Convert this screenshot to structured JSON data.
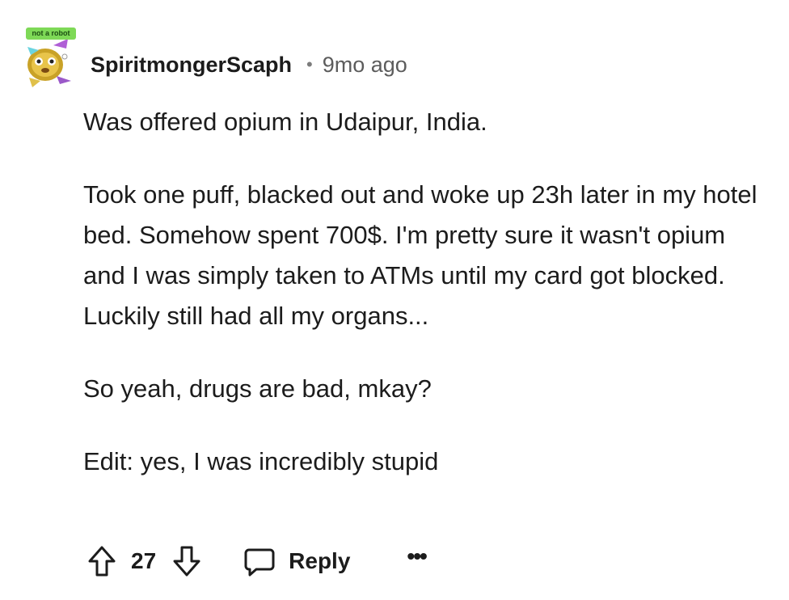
{
  "comment": {
    "avatar": {
      "badge_text": "not a robot",
      "icon": "robot-avatar-icon"
    },
    "username": "SpiritmongerScaph",
    "separator": "•",
    "timestamp": "9mo ago",
    "paragraphs": [
      "Was offered opium in Udaipur, India.",
      "Took one puff, blacked out and woke up 23h later in my hotel bed. Somehow spent 700$. I'm pretty sure it wasn't opium and I was simply taken to ATMs until my card got blocked. Luckily still had all my organs...",
      "So yeah, drugs are bad, mkay?",
      "Edit: yes, I was incredibly stupid"
    ],
    "actions": {
      "upvote_icon": "upvote-arrow-icon",
      "vote_count": "27",
      "downvote_icon": "downvote-arrow-icon",
      "reply_icon": "speech-bubble-icon",
      "reply_label": "Reply",
      "more_label": "•••"
    }
  },
  "colors": {
    "text": "#1c1c1c",
    "meta": "#5c5c5c",
    "badge": "#7ed957"
  }
}
